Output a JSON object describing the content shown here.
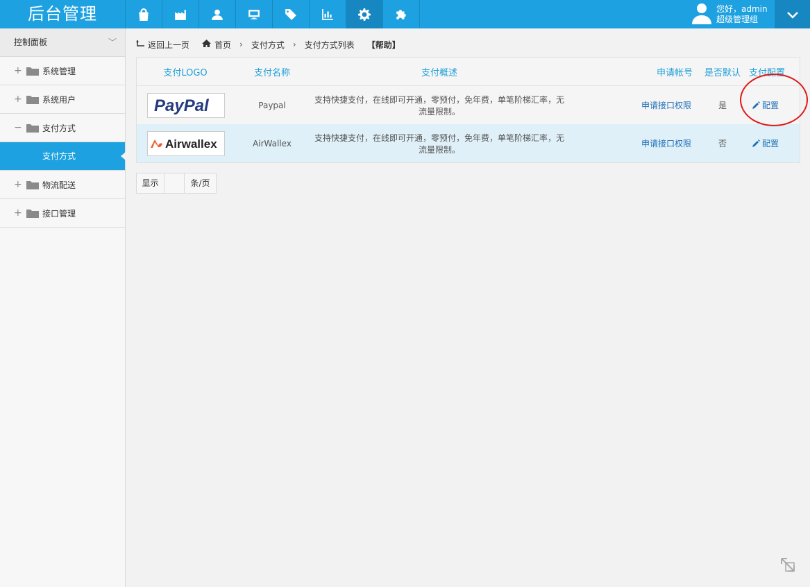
{
  "brand": "后台管理",
  "nav_icons": [
    "bag-icon",
    "factory-icon",
    "user-icon",
    "monitor-icon",
    "tag-icon",
    "bar-chart-icon",
    "gear-icon",
    "puzzle-icon"
  ],
  "user": {
    "greeting": "您好，admin",
    "role": "超级管理组"
  },
  "sidebar": {
    "header": "控制面板",
    "items": [
      {
        "label": "系统管理",
        "sign": "+"
      },
      {
        "label": "系统用户",
        "sign": "+"
      },
      {
        "label": "支付方式",
        "sign": "−"
      },
      {
        "label": "支付方式",
        "sub": true
      },
      {
        "label": "物流配送",
        "sign": "+"
      },
      {
        "label": "接口管理",
        "sign": "+"
      }
    ]
  },
  "breadcrumb": {
    "back": "返回上一页",
    "home": "首页",
    "level1": "支付方式",
    "level2": "支付方式列表",
    "help": "【帮助】"
  },
  "table": {
    "headers": [
      "支付LOGO",
      "支付名称",
      "支付概述",
      "申请帐号",
      "是否默认",
      "支付配置"
    ],
    "rows": [
      {
        "logo": "PayPal",
        "name": "Paypal",
        "desc": "支持快捷支付，在线即可开通，零预付，免年费，单笔阶梯汇率，无流量限制。",
        "apply": "申请接口权限",
        "default": "是",
        "config": "配置"
      },
      {
        "logo": "Airwallex",
        "name": "AirWallex",
        "desc": "支持快捷支付，在线即可开通，零预付，免年费，单笔阶梯汇率，无流量限制。",
        "apply": "申请接口权限",
        "default": "否",
        "config": "配置"
      }
    ]
  },
  "pager": {
    "show": "显示",
    "value": "",
    "unit": "条/页"
  },
  "colors": {
    "accent": "#1ea1e0",
    "link": "#1f6fb8",
    "highlight": "#e01818"
  }
}
